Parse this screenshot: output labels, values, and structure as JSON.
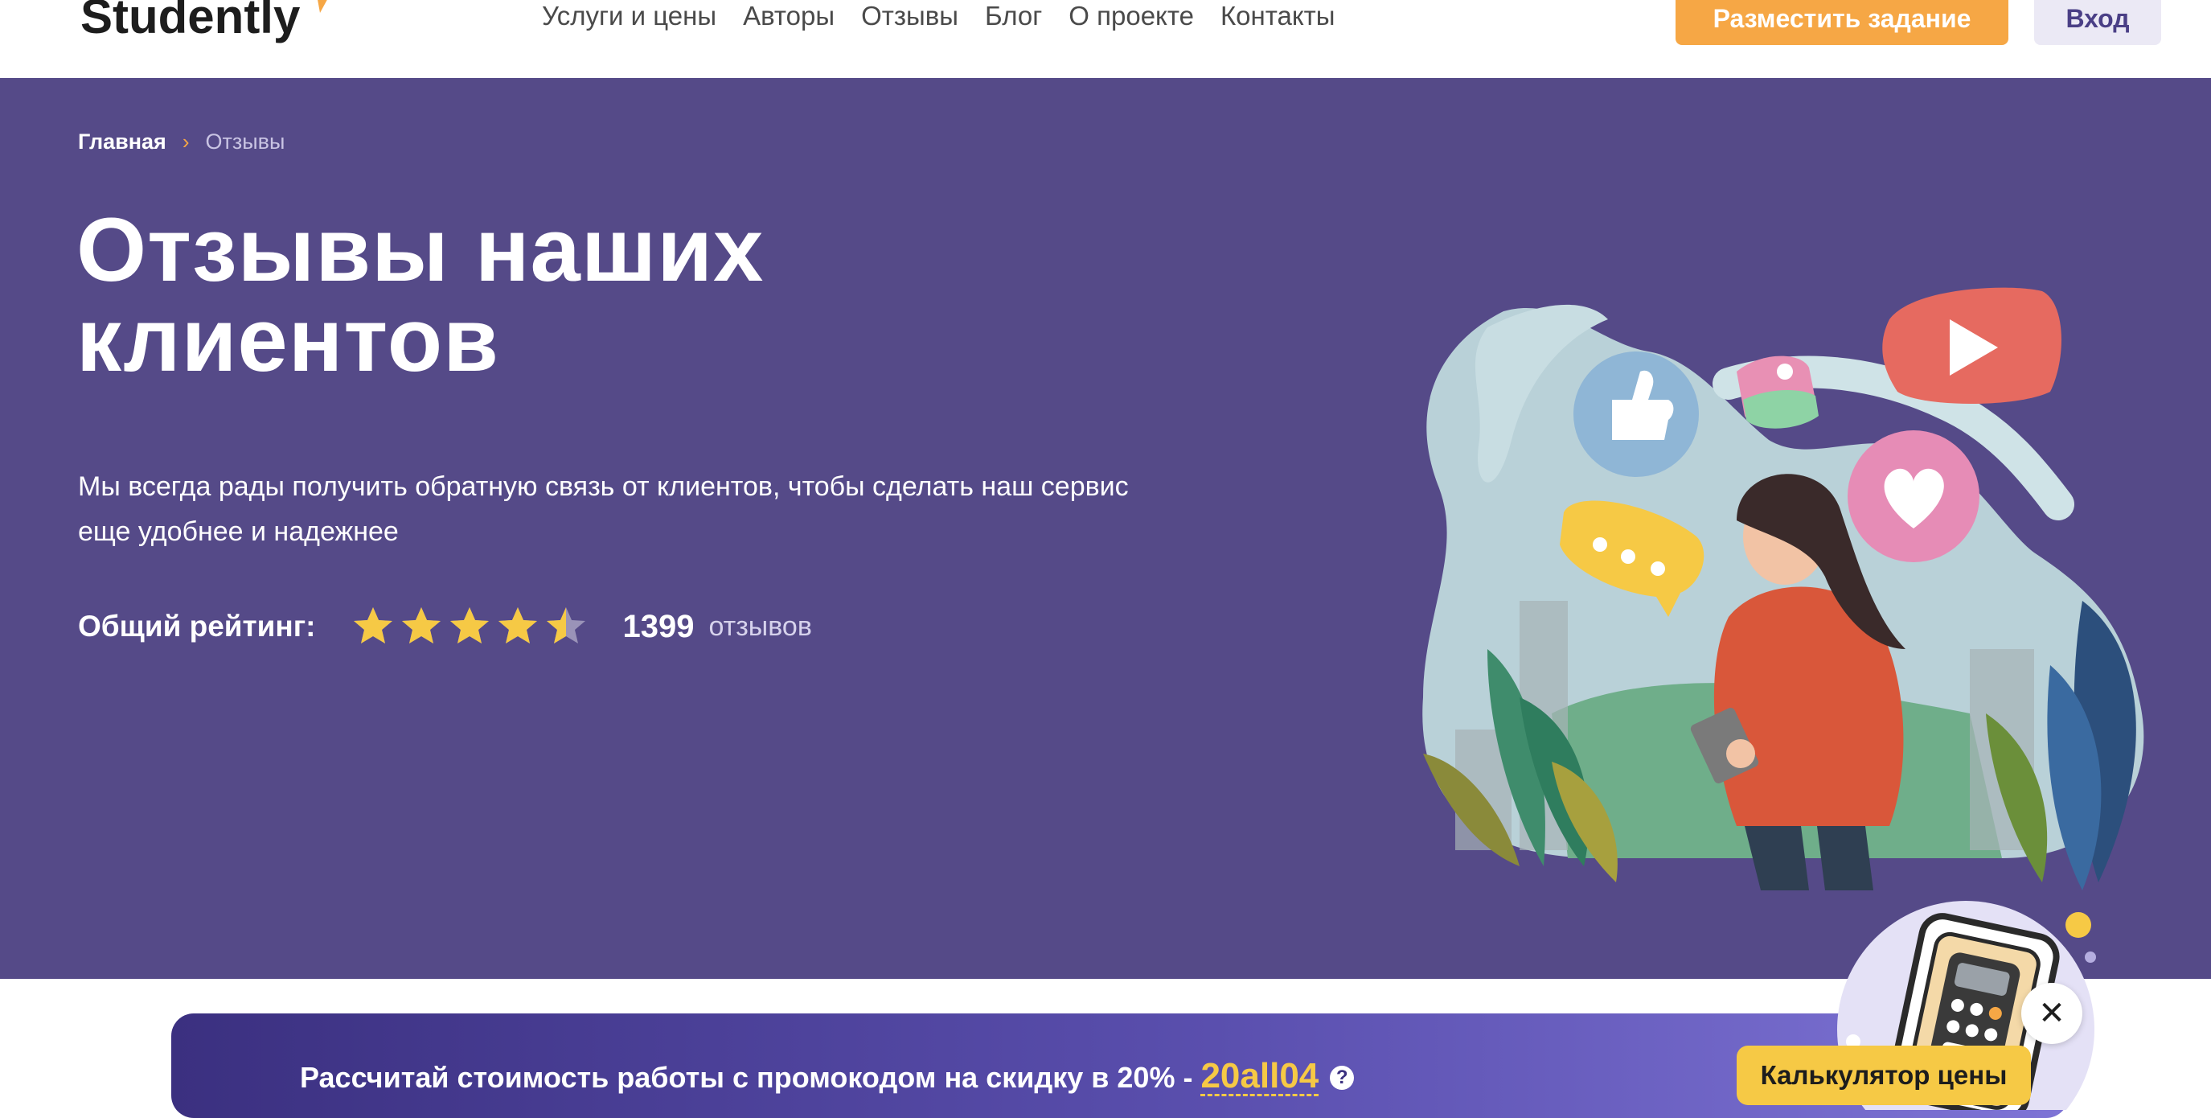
{
  "header": {
    "logo": "Studently",
    "nav": [
      "Услуги и цены",
      "Авторы",
      "Отзывы",
      "Блог",
      "О проекте",
      "Контакты"
    ],
    "post_task_label": "Разместить задание",
    "login_label": "Вход"
  },
  "breadcrumb": {
    "home": "Главная",
    "current": "Отзывы"
  },
  "hero": {
    "title_line1": "Отзывы наших",
    "title_line2": "клиентов",
    "description": "Мы всегда рады получить обратную связь от клиентов, чтобы сделать наш сервис еще удобнее и надежнее",
    "rating_label": "Общий рейтинг:",
    "rating_value": 4.5,
    "rating_max": 5,
    "review_count": "1399",
    "review_word": "отзывов"
  },
  "promo": {
    "text": "Рассчитай стоимость работы с промокодом на скидку в 20% -",
    "code": "20all04",
    "calc_button_label": "Калькулятор цены"
  },
  "colors": {
    "hero_bg": "#554a88",
    "accent_orange": "#f6a745",
    "star_yellow": "#f6c945",
    "login_bg": "#ebe9f5"
  },
  "icons": [
    "chevron-right-icon",
    "star-icon",
    "help-icon",
    "close-icon",
    "thumbs-up-icon",
    "play-icon",
    "heart-icon",
    "chat-bubble-icon",
    "calculator-icon"
  ]
}
